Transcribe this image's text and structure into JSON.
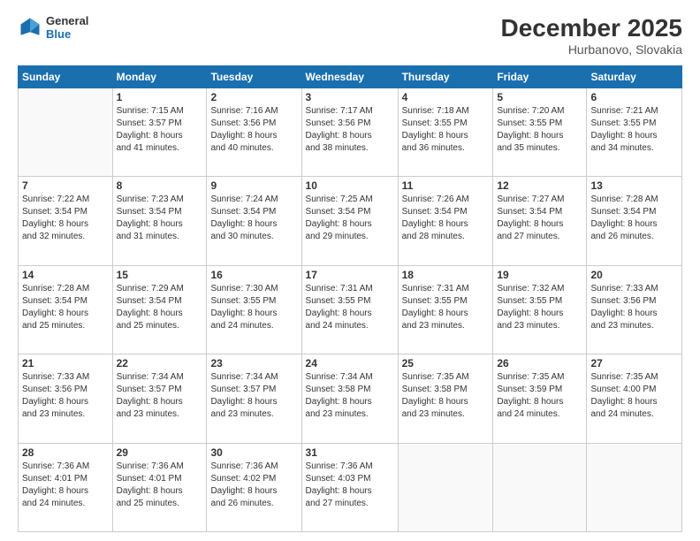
{
  "logo": {
    "line1": "General",
    "line2": "Blue"
  },
  "title": "December 2025",
  "subtitle": "Hurbanovo, Slovakia",
  "days_header": [
    "Sunday",
    "Monday",
    "Tuesday",
    "Wednesday",
    "Thursday",
    "Friday",
    "Saturday"
  ],
  "weeks": [
    [
      {
        "num": "",
        "info": ""
      },
      {
        "num": "1",
        "info": "Sunrise: 7:15 AM\nSunset: 3:57 PM\nDaylight: 8 hours\nand 41 minutes."
      },
      {
        "num": "2",
        "info": "Sunrise: 7:16 AM\nSunset: 3:56 PM\nDaylight: 8 hours\nand 40 minutes."
      },
      {
        "num": "3",
        "info": "Sunrise: 7:17 AM\nSunset: 3:56 PM\nDaylight: 8 hours\nand 38 minutes."
      },
      {
        "num": "4",
        "info": "Sunrise: 7:18 AM\nSunset: 3:55 PM\nDaylight: 8 hours\nand 36 minutes."
      },
      {
        "num": "5",
        "info": "Sunrise: 7:20 AM\nSunset: 3:55 PM\nDaylight: 8 hours\nand 35 minutes."
      },
      {
        "num": "6",
        "info": "Sunrise: 7:21 AM\nSunset: 3:55 PM\nDaylight: 8 hours\nand 34 minutes."
      }
    ],
    [
      {
        "num": "7",
        "info": "Sunrise: 7:22 AM\nSunset: 3:54 PM\nDaylight: 8 hours\nand 32 minutes."
      },
      {
        "num": "8",
        "info": "Sunrise: 7:23 AM\nSunset: 3:54 PM\nDaylight: 8 hours\nand 31 minutes."
      },
      {
        "num": "9",
        "info": "Sunrise: 7:24 AM\nSunset: 3:54 PM\nDaylight: 8 hours\nand 30 minutes."
      },
      {
        "num": "10",
        "info": "Sunrise: 7:25 AM\nSunset: 3:54 PM\nDaylight: 8 hours\nand 29 minutes."
      },
      {
        "num": "11",
        "info": "Sunrise: 7:26 AM\nSunset: 3:54 PM\nDaylight: 8 hours\nand 28 minutes."
      },
      {
        "num": "12",
        "info": "Sunrise: 7:27 AM\nSunset: 3:54 PM\nDaylight: 8 hours\nand 27 minutes."
      },
      {
        "num": "13",
        "info": "Sunrise: 7:28 AM\nSunset: 3:54 PM\nDaylight: 8 hours\nand 26 minutes."
      }
    ],
    [
      {
        "num": "14",
        "info": "Sunrise: 7:28 AM\nSunset: 3:54 PM\nDaylight: 8 hours\nand 25 minutes."
      },
      {
        "num": "15",
        "info": "Sunrise: 7:29 AM\nSunset: 3:54 PM\nDaylight: 8 hours\nand 25 minutes."
      },
      {
        "num": "16",
        "info": "Sunrise: 7:30 AM\nSunset: 3:55 PM\nDaylight: 8 hours\nand 24 minutes."
      },
      {
        "num": "17",
        "info": "Sunrise: 7:31 AM\nSunset: 3:55 PM\nDaylight: 8 hours\nand 24 minutes."
      },
      {
        "num": "18",
        "info": "Sunrise: 7:31 AM\nSunset: 3:55 PM\nDaylight: 8 hours\nand 23 minutes."
      },
      {
        "num": "19",
        "info": "Sunrise: 7:32 AM\nSunset: 3:55 PM\nDaylight: 8 hours\nand 23 minutes."
      },
      {
        "num": "20",
        "info": "Sunrise: 7:33 AM\nSunset: 3:56 PM\nDaylight: 8 hours\nand 23 minutes."
      }
    ],
    [
      {
        "num": "21",
        "info": "Sunrise: 7:33 AM\nSunset: 3:56 PM\nDaylight: 8 hours\nand 23 minutes."
      },
      {
        "num": "22",
        "info": "Sunrise: 7:34 AM\nSunset: 3:57 PM\nDaylight: 8 hours\nand 23 minutes."
      },
      {
        "num": "23",
        "info": "Sunrise: 7:34 AM\nSunset: 3:57 PM\nDaylight: 8 hours\nand 23 minutes."
      },
      {
        "num": "24",
        "info": "Sunrise: 7:34 AM\nSunset: 3:58 PM\nDaylight: 8 hours\nand 23 minutes."
      },
      {
        "num": "25",
        "info": "Sunrise: 7:35 AM\nSunset: 3:58 PM\nDaylight: 8 hours\nand 23 minutes."
      },
      {
        "num": "26",
        "info": "Sunrise: 7:35 AM\nSunset: 3:59 PM\nDaylight: 8 hours\nand 24 minutes."
      },
      {
        "num": "27",
        "info": "Sunrise: 7:35 AM\nSunset: 4:00 PM\nDaylight: 8 hours\nand 24 minutes."
      }
    ],
    [
      {
        "num": "28",
        "info": "Sunrise: 7:36 AM\nSunset: 4:01 PM\nDaylight: 8 hours\nand 24 minutes."
      },
      {
        "num": "29",
        "info": "Sunrise: 7:36 AM\nSunset: 4:01 PM\nDaylight: 8 hours\nand 25 minutes."
      },
      {
        "num": "30",
        "info": "Sunrise: 7:36 AM\nSunset: 4:02 PM\nDaylight: 8 hours\nand 26 minutes."
      },
      {
        "num": "31",
        "info": "Sunrise: 7:36 AM\nSunset: 4:03 PM\nDaylight: 8 hours\nand 27 minutes."
      },
      {
        "num": "",
        "info": ""
      },
      {
        "num": "",
        "info": ""
      },
      {
        "num": "",
        "info": ""
      }
    ]
  ]
}
